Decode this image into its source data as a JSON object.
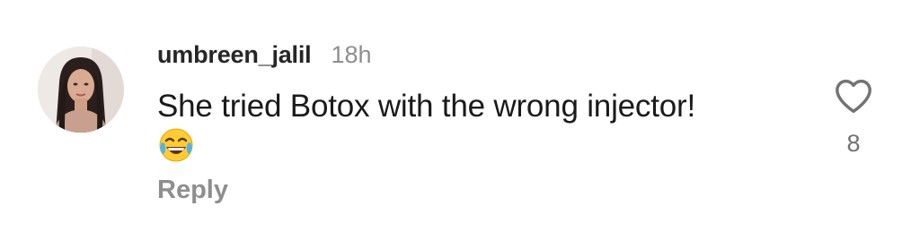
{
  "comment": {
    "username": "umbreen_jalil",
    "timestamp": "18h",
    "text": "She tried Botox with the wrong injector!",
    "emoji": "face-with-tears-of-joy",
    "like_count": "8",
    "reply_label": "Reply"
  },
  "icons": {
    "like": "heart-outline-icon",
    "emoji": "face-with-tears-of-joy-icon"
  },
  "colors": {
    "username": "#262626",
    "muted": "#8e8e8e",
    "text": "#1a1a1a",
    "background": "#ffffff"
  }
}
